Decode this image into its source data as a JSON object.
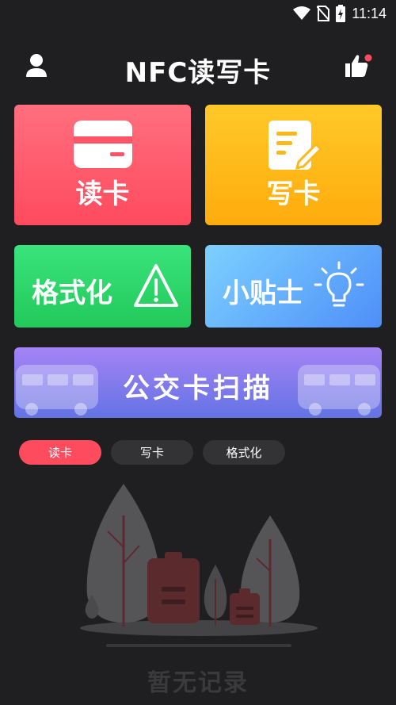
{
  "status_bar": {
    "time": "11:14",
    "icons": [
      "wifi-icon",
      "no-sim-icon",
      "battery-charging-icon"
    ]
  },
  "header": {
    "title": "NFC读写卡",
    "left_icon": "user-icon",
    "right_icon": "thumbs-up-icon"
  },
  "cards": {
    "read": {
      "label": "读卡",
      "icon": "card-icon"
    },
    "write": {
      "label": "写卡",
      "icon": "edit-document-icon"
    },
    "format": {
      "label": "格式化",
      "icon": "warning-icon"
    },
    "tips": {
      "label": "小贴士",
      "icon": "lightbulb-icon"
    },
    "bus": {
      "label": "公交卡扫描",
      "icon": "bus-icon"
    }
  },
  "tabs": [
    {
      "label": "读卡",
      "active": true
    },
    {
      "label": "写卡",
      "active": false
    },
    {
      "label": "格式化",
      "active": false
    }
  ],
  "empty_state": {
    "text": "暂无记录",
    "illustration": "empty-records-illustration"
  },
  "colors": {
    "background": "#1f1f21",
    "read": "#ff4a5e",
    "write": "#ffab0d",
    "format": "#22c95a",
    "tips": "#4e8ff9",
    "bus": "#7b7bea",
    "tab_active": "#ff4b5e",
    "tab_inactive": "#333335"
  }
}
